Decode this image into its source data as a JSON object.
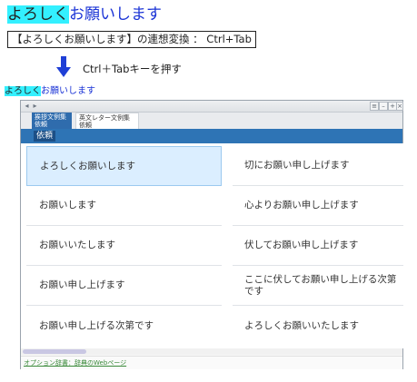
{
  "header": {
    "highlight_text": "よろしく",
    "rest_text": "お願いします"
  },
  "shortcut_box": {
    "text": "【よろしくお願いします】の連想変換 ： Ctrl+Tab"
  },
  "instruction": {
    "arrow_icon": "down-arrow-icon",
    "text": "Ctrl＋Tabキーを押す"
  },
  "input_echo": {
    "highlight_text": "よろしく",
    "rest_text": "お願いします"
  },
  "ime_window": {
    "tabs": [
      {
        "line1": "挨拶文例集",
        "line2": "依頼"
      },
      {
        "line1": "英文レター文例集",
        "line2": "依頼"
      }
    ],
    "category_label": "依頼",
    "candidates_left": [
      "よろしくお願いします",
      "お願いします",
      "お願いいたします",
      "お願い申し上げます",
      "お願い申し上げる次第です"
    ],
    "candidates_right": [
      "切にお願い申し上げます",
      "心よりお願い申し上げます",
      "伏してお願い申し上げます",
      "ここに伏してお願い申し上げる次第です",
      "よろしくお願いいたします"
    ],
    "footer_link": "オプション辞書：辞典のWebページ"
  }
}
